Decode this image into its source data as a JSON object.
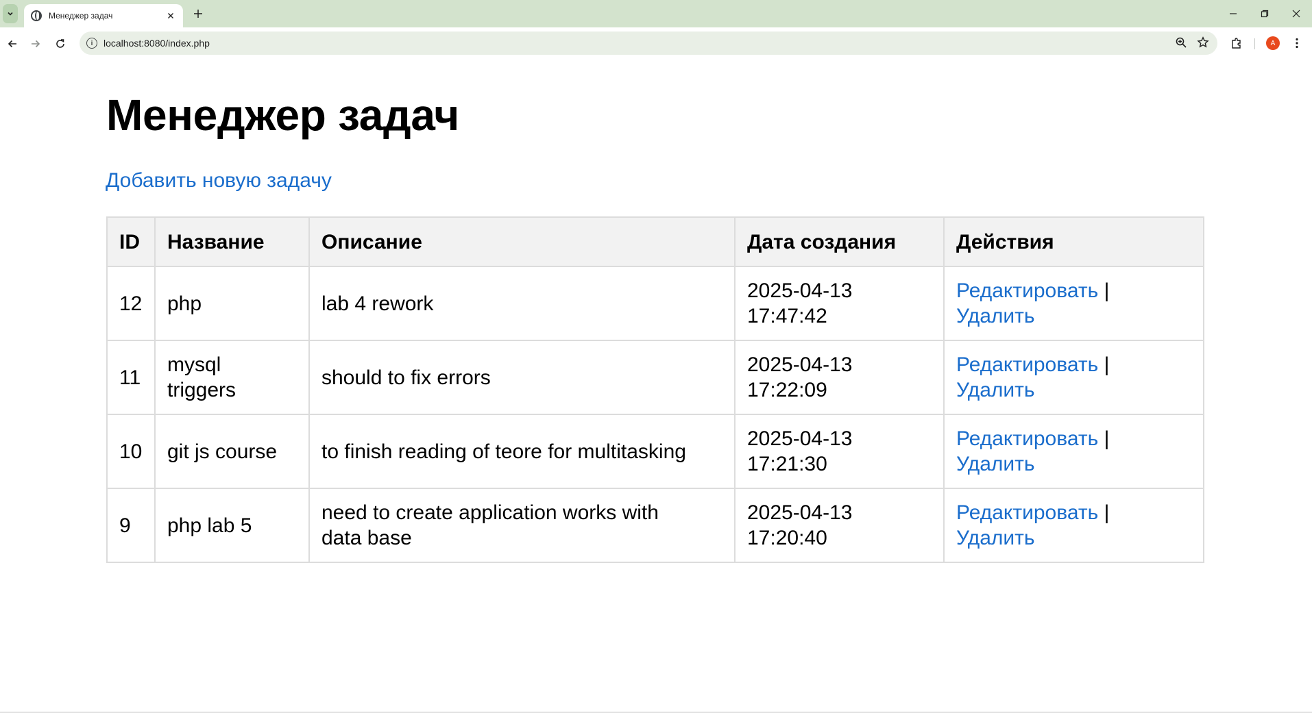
{
  "browser": {
    "tab_title": "Менеджер задач",
    "url": "localhost:8080/index.php",
    "avatar_letter": "A",
    "accent_color": "#d3e3cd"
  },
  "page": {
    "title": "Менеджер задач",
    "add_link": "Добавить новую задачу"
  },
  "table": {
    "headers": {
      "id": "ID",
      "name": "Название",
      "description": "Описание",
      "created": "Дата создания",
      "actions": "Действия"
    },
    "rows": [
      {
        "id": "12",
        "name": "php",
        "description": "lab 4 rework",
        "date": "2025-04-13",
        "time": "17:47:42"
      },
      {
        "id": "11",
        "name_line1": "mysql",
        "name_line2": "triggers",
        "description": "should to fix errors",
        "date": "2025-04-13",
        "time": "17:22:09"
      },
      {
        "id": "10",
        "name": "git js course",
        "description": "to finish reading of teore for multitasking",
        "date": "2025-04-13",
        "time": "17:21:30"
      },
      {
        "id": "9",
        "name": "php lab 5",
        "description_line1": "need to create application works with",
        "description_line2": "data base",
        "date": "2025-04-13",
        "time": "17:20:40"
      }
    ],
    "edit_label": "Редактировать",
    "separator": "|",
    "delete_label": "Удалить",
    "link_color": "#1a6dcc"
  }
}
